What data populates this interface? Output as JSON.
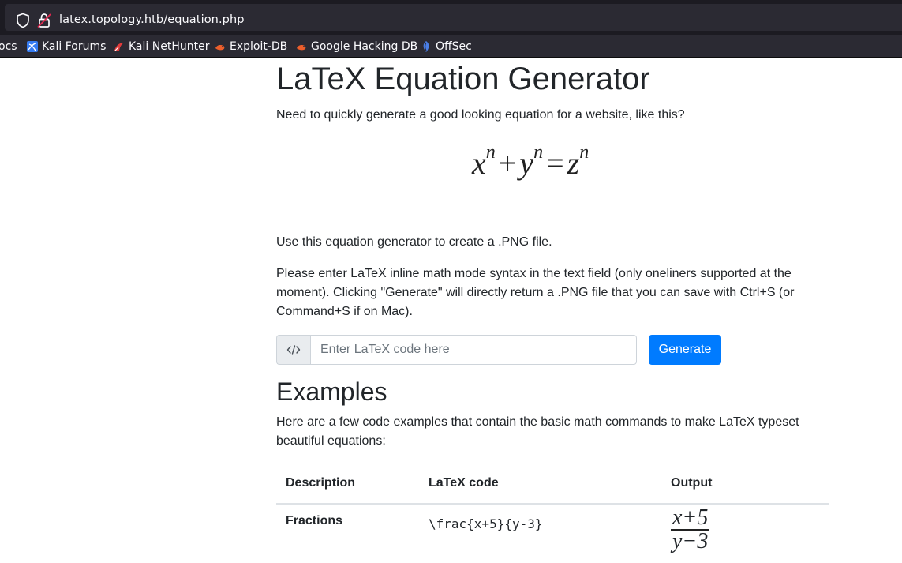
{
  "browser": {
    "url_host": "latex.topology.htb",
    "url_path": "/equation.php",
    "bookmarks": [
      {
        "label": "ocs",
        "icon": "docs-icon"
      },
      {
        "label": "Kali Forums",
        "icon": "kali-forums-icon"
      },
      {
        "label": "Kali NetHunter",
        "icon": "kali-nethunter-icon"
      },
      {
        "label": "Exploit-DB",
        "icon": "exploit-db-icon"
      },
      {
        "label": "Google Hacking DB",
        "icon": "ghdb-icon"
      },
      {
        "label": "OffSec",
        "icon": "offsec-icon"
      }
    ]
  },
  "page": {
    "title": "LaTeX Equation Generator",
    "intro": "Need to quickly generate a good looking equation for a website, like this?",
    "hero_equation": {
      "x": "x",
      "y": "y",
      "z": "z",
      "exp": "n",
      "plus": "+",
      "equals": "="
    },
    "use_text": "Use this equation generator to create a .PNG file.",
    "enter_text": "Please enter LaTeX inline math mode syntax in the text field (only oneliners supported at the moment). Clicking \"Generate\" will directly return a .PNG file that you can save with Ctrl+S (or Command+S if on Mac).",
    "input": {
      "placeholder": "Enter LaTeX code here",
      "value": ""
    },
    "generate_label": "Generate",
    "examples_heading": "Examples",
    "examples_desc": "Here are a few code examples that contain the basic math commands to make LaTeX typeset beautiful equations:",
    "table": {
      "headers": [
        "Description",
        "LaTeX code",
        "Output"
      ],
      "rows": [
        {
          "description": "Fractions",
          "code": "\\frac{x+5}{y-3}",
          "output_num": "x+5",
          "output_den": "y−3"
        }
      ]
    }
  },
  "colors": {
    "primary": "#007bff",
    "text": "#212529",
    "browser_bg": "#1c1b22",
    "browser_toolbar": "#2b2a33"
  }
}
